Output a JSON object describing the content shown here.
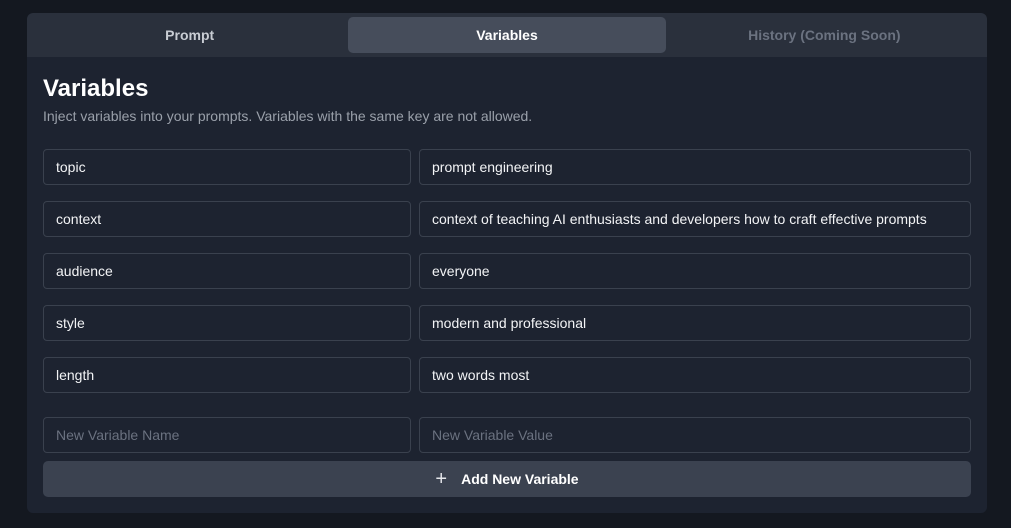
{
  "tabs": [
    {
      "label": "Prompt"
    },
    {
      "label": "Variables"
    },
    {
      "label": "History (Coming Soon)"
    }
  ],
  "section": {
    "title": "Variables",
    "subtitle": "Inject variables into your prompts. Variables with the same key are not allowed."
  },
  "variables": [
    {
      "name": "topic",
      "value": "prompt engineering"
    },
    {
      "name": "context",
      "value": "context of teaching AI enthusiasts and developers how to craft effective prompts"
    },
    {
      "name": "audience",
      "value": "everyone"
    },
    {
      "name": "style",
      "value": "modern and professional"
    },
    {
      "name": "length",
      "value": "two words most"
    }
  ],
  "new_variable": {
    "name_placeholder": "New Variable Name",
    "value_placeholder": "New Variable Value",
    "add_label": "Add New Variable",
    "add_icon": "plus-icon"
  },
  "colors": {
    "background": "#141820",
    "panel": "#1d2330",
    "active_tab": "#464d5b"
  }
}
